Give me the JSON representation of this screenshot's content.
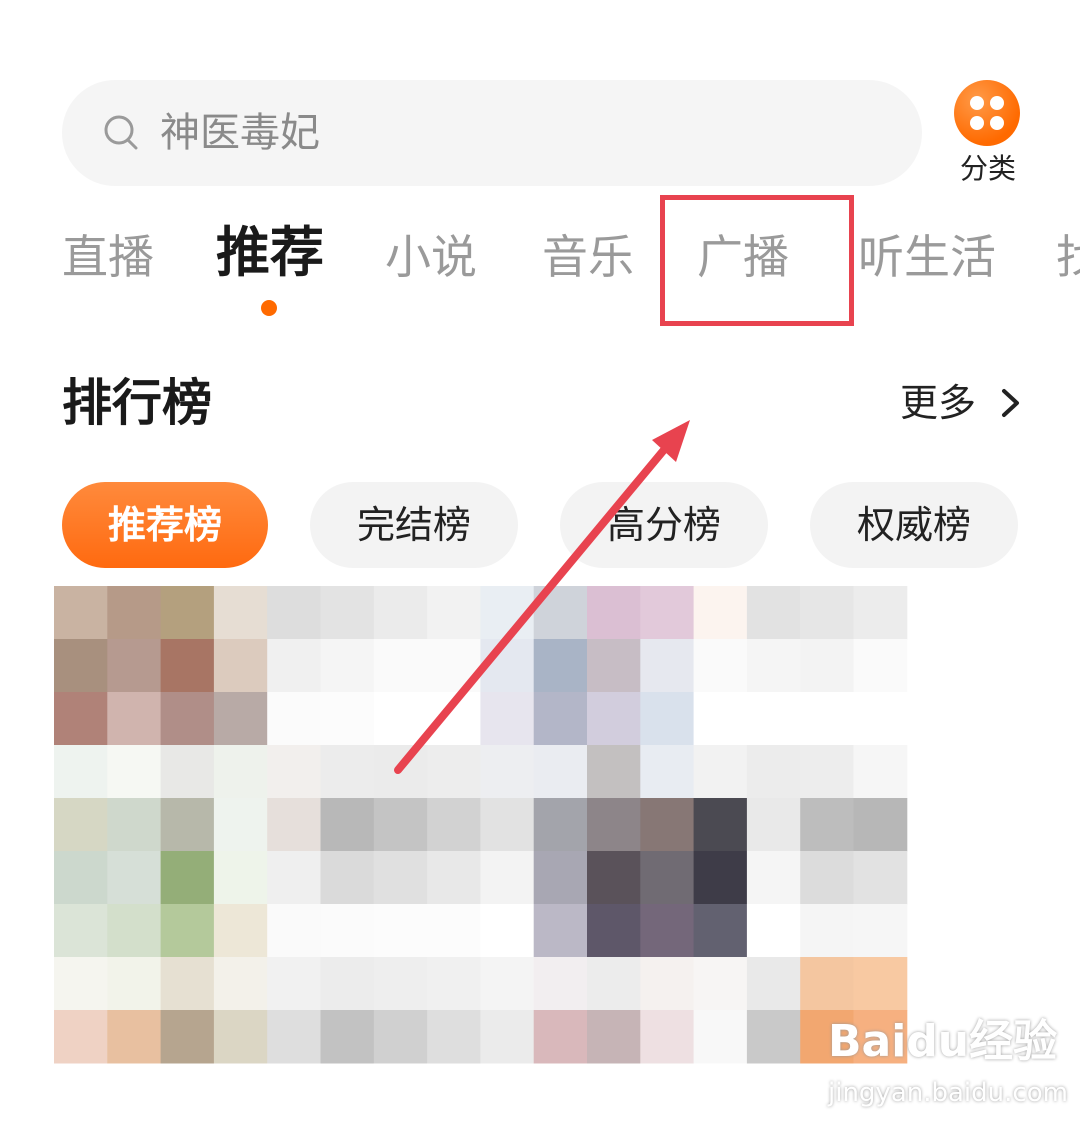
{
  "search": {
    "placeholder": "神医毒妃"
  },
  "category_button": {
    "label": "分类"
  },
  "tabs": [
    {
      "label": "直播"
    },
    {
      "label": "推荐"
    },
    {
      "label": "小说"
    },
    {
      "label": "音乐"
    },
    {
      "label": "广播"
    },
    {
      "label": "听生活"
    },
    {
      "label": "找"
    }
  ],
  "active_tab": "推荐",
  "section": {
    "title": "排行榜",
    "more_label": "更多"
  },
  "chips": [
    {
      "label": "推荐榜"
    },
    {
      "label": "完结榜"
    },
    {
      "label": "高分榜"
    },
    {
      "label": "权威榜"
    }
  ],
  "watermark": {
    "logo": "Baidu经验",
    "url": "jingyan.baidu.com"
  },
  "colors": {
    "accent": "#ff6a00",
    "annotation": "#e8434f"
  }
}
